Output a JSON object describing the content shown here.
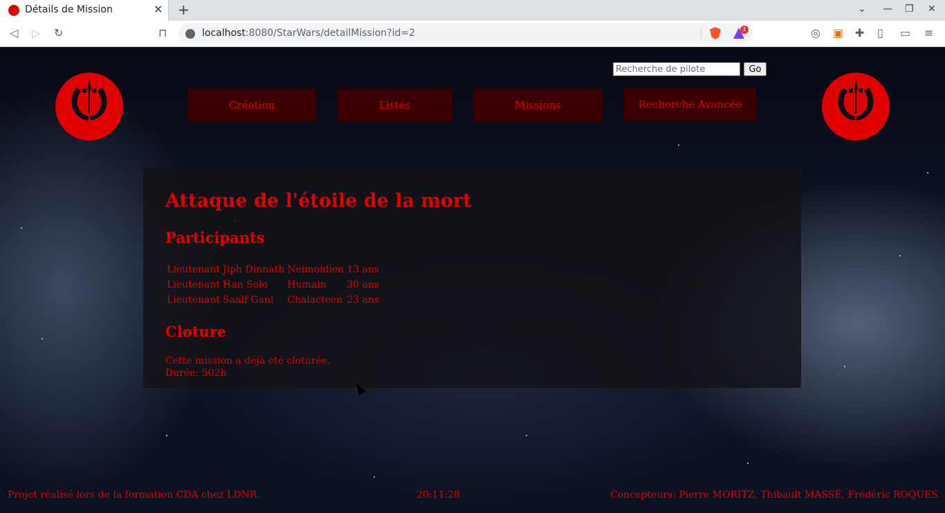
{
  "browser": {
    "tab_title": "Détails de Mission",
    "url_host": "localhost",
    "url_rest": ":8080/StarWars/detailMission?id=2",
    "rewards_badge": "1",
    "accent_color": "#e00000"
  },
  "header": {
    "search_placeholder": "Recherche de pilote",
    "search_button": "Go",
    "nav": [
      "Création",
      "Listes",
      "Missions",
      "Recherche Avancée"
    ]
  },
  "mission": {
    "title": "Attaque de l'étoile de la mort",
    "participants_heading": "Participants",
    "participants": [
      {
        "rank": "Lieutenant",
        "name": "Jiph Dinnath",
        "race": "Neimoidien",
        "age": "13 ans"
      },
      {
        "rank": "Lieutenant",
        "name": "Han Solo",
        "race": "Humain",
        "age": "30 ans"
      },
      {
        "rank": "Lieutenant",
        "name": "Saalf Gani",
        "race": "Chalacteen",
        "age": "23 ans"
      }
    ],
    "closure_heading": "Cloture",
    "closure_status": "Cette mission a déjà été cloturée.",
    "closure_duration": "Durée: 502h"
  },
  "footer": {
    "left": "Projet réalisé lors de la formation CDA chez LDNR.",
    "time": "20:11:28",
    "right": "Concepteurs: Pierre MORITZ, Thibault MASSÉ, Frédéric ROQUES"
  }
}
